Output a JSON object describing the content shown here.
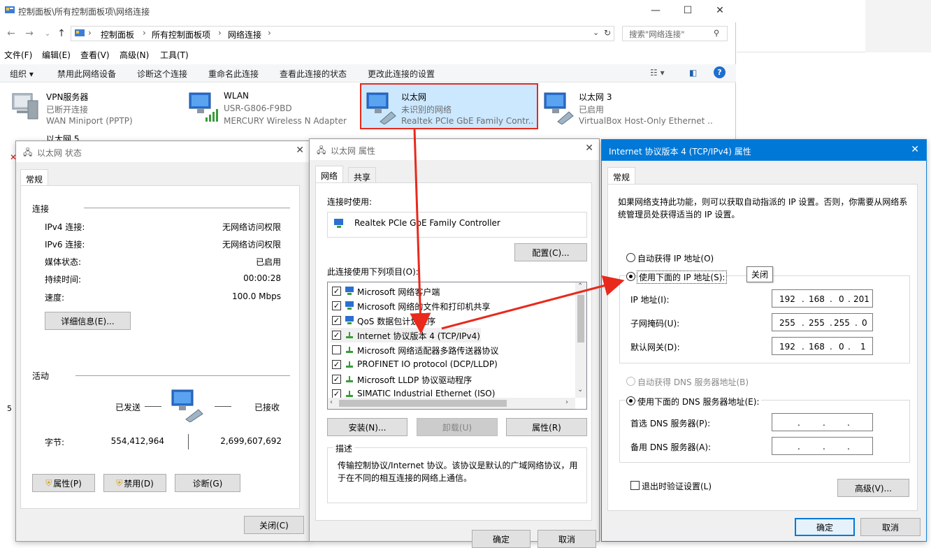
{
  "explorer": {
    "title": "控制面板\\所有控制面板项\\网络连接",
    "breadcrumb": [
      "控制面板",
      "所有控制面板项",
      "网络连接"
    ],
    "search_placeholder": "搜索\"网络连接\"",
    "menu": [
      "文件(F)",
      "编辑(E)",
      "查看(V)",
      "高级(N)",
      "工具(T)"
    ],
    "commands": [
      "组织 ▾",
      "禁用此网络设备",
      "诊断这个连接",
      "重命名此连接",
      "查看此连接的状态",
      "更改此连接的设置"
    ],
    "adapters": [
      {
        "name": "VPN服务器",
        "status": "已断开连接",
        "device": "WAN Miniport (PPTP)"
      },
      {
        "name": "WLAN",
        "status": "USR-G806-F9BD",
        "device": "MERCURY Wireless N Adapter"
      },
      {
        "name": "以太网",
        "status": "未识别的网络",
        "device": "Realtek PCIe GbE Family Contr..."
      },
      {
        "name": "以太网 3",
        "status": "已启用",
        "device": "VirtualBox Host-Only Ethernet ..."
      },
      {
        "name": "以太网 5"
      }
    ],
    "left_edge_digit": "5"
  },
  "status_dialog": {
    "title": "以太网 状态",
    "tab": "常规",
    "connection_header": "连接",
    "rows": [
      {
        "label": "IPv4 连接:",
        "value": "无网络访问权限"
      },
      {
        "label": "IPv6 连接:",
        "value": "无网络访问权限"
      },
      {
        "label": "媒体状态:",
        "value": "已启用"
      },
      {
        "label": "持续时间:",
        "value": "00:00:28"
      },
      {
        "label": "速度:",
        "value": "100.0 Mbps"
      }
    ],
    "details_button": "详细信息(E)...",
    "activity_header": "活动",
    "sent_label": "已发送",
    "received_label": "已接收",
    "bytes_label": "字节:",
    "bytes_sent": "554,412,964",
    "bytes_received": "2,699,607,692",
    "properties_button": "属性(P)",
    "disable_button": "禁用(D)",
    "diagnose_button": "诊断(G)",
    "close_button": "关闭(C)"
  },
  "props_dialog": {
    "title": "以太网 属性",
    "tabs": [
      "网络",
      "共享"
    ],
    "connect_using_label": "连接时使用:",
    "adapter_name": "Realtek PCIe GbE Family Controller",
    "configure_button": "配置(C)...",
    "items_label": "此连接使用下列项目(O):",
    "items": [
      {
        "label": "Microsoft 网络客户端",
        "checked": true
      },
      {
        "label": "Microsoft 网络的文件和打印机共享",
        "checked": true
      },
      {
        "label": "QoS 数据包计划程序",
        "checked": true
      },
      {
        "label": "Internet 协议版本 4 (TCP/IPv4)",
        "checked": true
      },
      {
        "label": "Microsoft 网络适配器多路传送器协议",
        "checked": false
      },
      {
        "label": "PROFINET IO protocol (DCP/LLDP)",
        "checked": true
      },
      {
        "label": "Microsoft LLDP 协议驱动程序",
        "checked": true
      },
      {
        "label": "SIMATIC Industrial Ethernet (ISO)",
        "checked": true
      }
    ],
    "install_button": "安装(N)...",
    "uninstall_button": "卸载(U)",
    "properties_button": "属性(R)",
    "description_header": "描述",
    "description": "传输控制协议/Internet 协议。该协议是默认的广域网络协议，用于在不同的相互连接的网络上通信。",
    "ok_button": "确定",
    "cancel_button": "取消"
  },
  "ipv4_dialog": {
    "title": "Internet 协议版本 4 (TCP/IPv4) 属性",
    "tab": "常规",
    "info": "如果网络支持此功能，则可以获取自动指派的 IP 设置。否则，你需要从网络系统管理员处获得适当的 IP 设置。",
    "auto_ip": "自动获得 IP 地址(O)",
    "manual_ip": "使用下面的 IP 地址(S):",
    "tooltip": "关闭",
    "ip_label": "IP 地址(I):",
    "ip": [
      "192",
      "168",
      "0",
      "201"
    ],
    "mask_label": "子网掩码(U):",
    "mask": [
      "255",
      "255",
      "255",
      "0"
    ],
    "gateway_label": "默认网关(D):",
    "gateway": [
      "192",
      "168",
      "0",
      "1"
    ],
    "auto_dns": "自动获得 DNS 服务器地址(B)",
    "manual_dns": "使用下面的 DNS 服务器地址(E):",
    "dns1_label": "首选 DNS 服务器(P):",
    "dns2_label": "备用 DNS 服务器(A):",
    "validate_label": "退出时验证设置(L)",
    "advanced_button": "高级(V)...",
    "ok_button": "确定",
    "cancel_button": "取消"
  },
  "colors": {
    "highlight": "#e8291c",
    "accent": "#0078d7",
    "selection": "#cce8ff"
  }
}
